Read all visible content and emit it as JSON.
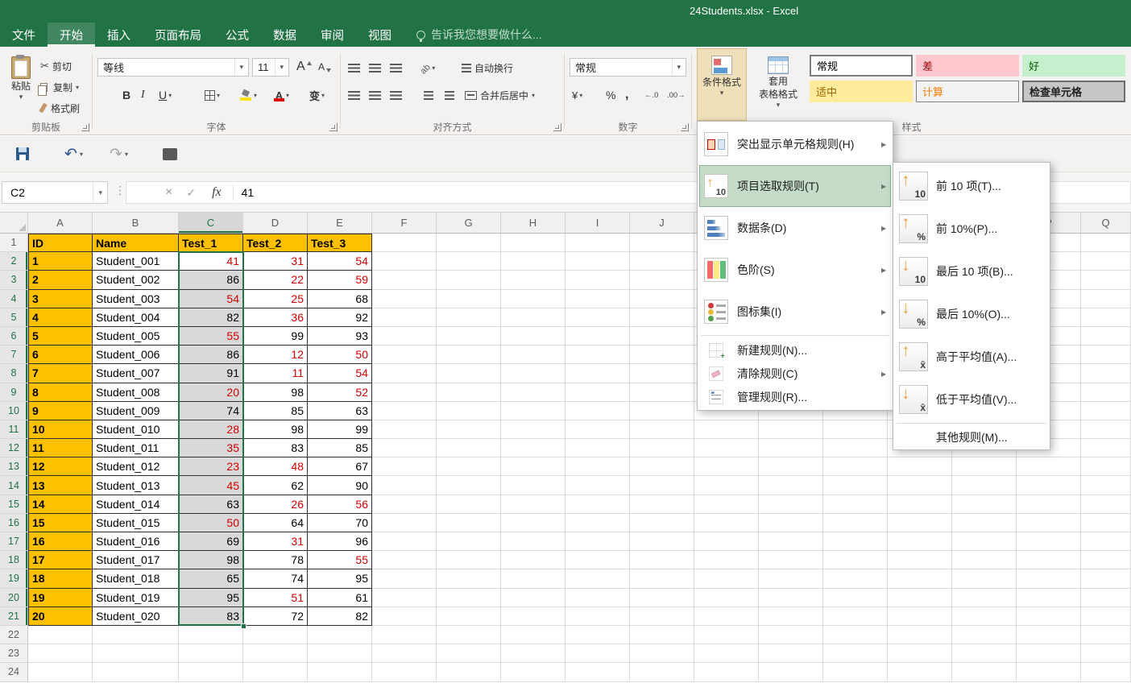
{
  "titlebar": {
    "title": "24Students.xlsx - Excel"
  },
  "tabs": {
    "file": "文件",
    "items": [
      "开始",
      "插入",
      "页面布局",
      "公式",
      "数据",
      "审阅",
      "视图"
    ],
    "active": "开始",
    "tellme": "告诉我您想要做什么..."
  },
  "ribbon": {
    "clipboard": {
      "group_label": "剪贴板",
      "paste": "粘贴",
      "cut": "剪切",
      "copy": "复制",
      "format_painter": "格式刷"
    },
    "font": {
      "group_label": "字体",
      "font_name": "等线",
      "font_size": "11",
      "bold_glyph": "B",
      "italic_glyph": "I",
      "underline_glyph": "U",
      "grow_font_glyph": "A",
      "shrink_font_glyph": "A",
      "font_color_glyph": "A",
      "phonetic_glyph": "变"
    },
    "alignment": {
      "group_label": "对齐方式",
      "wrap_text": "自动换行",
      "merge_center": "合并后居中"
    },
    "number": {
      "group_label": "数字",
      "format": "常规",
      "accounting_glyph": "¥",
      "percent_glyph": "%",
      "comma_glyph": ",",
      "increase_decimal_glyph": "←.0",
      "decrease_decimal_glyph": ".00→"
    },
    "styles": {
      "group_label": "样式",
      "conditional_formatting": "条件格式",
      "format_as_table_line1": "套用",
      "format_as_table_line2": "表格格式",
      "gallery": [
        {
          "label": "常规"
        },
        {
          "label": "差"
        },
        {
          "label": "好"
        },
        {
          "label": "适中"
        },
        {
          "label": "计算"
        },
        {
          "label": "检查单元格"
        }
      ]
    }
  },
  "quick_access": {
    "undo_glyph": "↶",
    "redo_glyph": "↷"
  },
  "formula_bar": {
    "name_box": "C2",
    "cancel_glyph": "×",
    "enter_glyph": "✓",
    "fx_glyph": "fx",
    "value": "41"
  },
  "cf_menu": {
    "items": [
      {
        "label": "突出显示单元格规则(H)",
        "icon": "highlight-cells-rules-icon",
        "has_submenu": true
      },
      {
        "label": "项目选取规则(T)",
        "icon": "top-bottom-rules-icon",
        "has_submenu": true,
        "highlighted": true,
        "icon_arrow": "↑",
        "icon_text": "10"
      },
      {
        "label": "数据条(D)",
        "icon": "data-bars-icon",
        "has_submenu": true
      },
      {
        "label": "色阶(S)",
        "icon": "color-scales-icon",
        "has_submenu": true
      },
      {
        "label": "图标集(I)",
        "icon": "icon-sets-icon",
        "has_submenu": true
      },
      {
        "label": "新建规则(N)...",
        "icon": "new-rule-icon",
        "has_submenu": false
      },
      {
        "label": "清除规则(C)",
        "icon": "clear-rules-icon",
        "has_submenu": true
      },
      {
        "label": "管理规则(R)...",
        "icon": "manage-rules-icon",
        "has_submenu": false
      }
    ]
  },
  "cf_submenu": {
    "items": [
      {
        "label": "前 10 项(T)...",
        "icon_arrow": "↑",
        "icon_text": "10"
      },
      {
        "label": "前 10%(P)...",
        "icon_arrow": "↑",
        "icon_text": "%"
      },
      {
        "label": "最后 10 项(B)...",
        "icon_arrow": "↓",
        "icon_text": "10"
      },
      {
        "label": "最后 10%(O)...",
        "icon_arrow": "↓",
        "icon_text": "%"
      },
      {
        "label": "高于平均值(A)...",
        "icon_arrow": "↑",
        "icon_text": "x̄"
      },
      {
        "label": "低于平均值(V)...",
        "icon_arrow": "↓",
        "icon_text": "x̄"
      },
      {
        "label": "其他规则(M)...",
        "icon_arrow": "",
        "icon_text": ""
      }
    ]
  },
  "grid": {
    "visible_columns": [
      "A",
      "B",
      "C",
      "D",
      "E",
      "F",
      "G",
      "H",
      "I",
      "J",
      "K",
      "L",
      "M",
      "N",
      "O",
      "P",
      "Q"
    ],
    "visible_row_count": 24,
    "header_row": [
      "ID",
      "Name",
      "Test_1",
      "Test_2",
      "Test_3"
    ],
    "students": [
      {
        "id": "1",
        "name": "Student_001",
        "scores": [
          {
            "v": 41,
            "red": true
          },
          {
            "v": 31,
            "red": true
          },
          {
            "v": 54,
            "red": true
          }
        ]
      },
      {
        "id": "2",
        "name": "Student_002",
        "scores": [
          {
            "v": 86,
            "red": false
          },
          {
            "v": 22,
            "red": true
          },
          {
            "v": 59,
            "red": true
          }
        ]
      },
      {
        "id": "3",
        "name": "Student_003",
        "scores": [
          {
            "v": 54,
            "red": true
          },
          {
            "v": 25,
            "red": true
          },
          {
            "v": 68,
            "red": false
          }
        ]
      },
      {
        "id": "4",
        "name": "Student_004",
        "scores": [
          {
            "v": 82,
            "red": false
          },
          {
            "v": 36,
            "red": true
          },
          {
            "v": 92,
            "red": false
          }
        ]
      },
      {
        "id": "5",
        "name": "Student_005",
        "scores": [
          {
            "v": 55,
            "red": true
          },
          {
            "v": 99,
            "red": false
          },
          {
            "v": 93,
            "red": false
          }
        ]
      },
      {
        "id": "6",
        "name": "Student_006",
        "scores": [
          {
            "v": 86,
            "red": false
          },
          {
            "v": 12,
            "red": true
          },
          {
            "v": 50,
            "red": true
          }
        ]
      },
      {
        "id": "7",
        "name": "Student_007",
        "scores": [
          {
            "v": 91,
            "red": false
          },
          {
            "v": 11,
            "red": true
          },
          {
            "v": 54,
            "red": true
          }
        ]
      },
      {
        "id": "8",
        "name": "Student_008",
        "scores": [
          {
            "v": 20,
            "red": true
          },
          {
            "v": 98,
            "red": false
          },
          {
            "v": 52,
            "red": true
          }
        ]
      },
      {
        "id": "9",
        "name": "Student_009",
        "scores": [
          {
            "v": 74,
            "red": false
          },
          {
            "v": 85,
            "red": false
          },
          {
            "v": 63,
            "red": false
          }
        ]
      },
      {
        "id": "10",
        "name": "Student_010",
        "scores": [
          {
            "v": 28,
            "red": true
          },
          {
            "v": 98,
            "red": false
          },
          {
            "v": 99,
            "red": false
          }
        ]
      },
      {
        "id": "11",
        "name": "Student_011",
        "scores": [
          {
            "v": 35,
            "red": true
          },
          {
            "v": 83,
            "red": false
          },
          {
            "v": 85,
            "red": false
          }
        ]
      },
      {
        "id": "12",
        "name": "Student_012",
        "scores": [
          {
            "v": 23,
            "red": true
          },
          {
            "v": 48,
            "red": true
          },
          {
            "v": 67,
            "red": false
          }
        ]
      },
      {
        "id": "13",
        "name": "Student_013",
        "scores": [
          {
            "v": 45,
            "red": true
          },
          {
            "v": 62,
            "red": false
          },
          {
            "v": 90,
            "red": false
          }
        ]
      },
      {
        "id": "14",
        "name": "Student_014",
        "scores": [
          {
            "v": 63,
            "red": false
          },
          {
            "v": 26,
            "red": true
          },
          {
            "v": 56,
            "red": true
          }
        ]
      },
      {
        "id": "15",
        "name": "Student_015",
        "scores": [
          {
            "v": 50,
            "red": true
          },
          {
            "v": 64,
            "red": false
          },
          {
            "v": 70,
            "red": false
          }
        ]
      },
      {
        "id": "16",
        "name": "Student_016",
        "scores": [
          {
            "v": 69,
            "red": false
          },
          {
            "v": 31,
            "red": true
          },
          {
            "v": 96,
            "red": false
          }
        ]
      },
      {
        "id": "17",
        "name": "Student_017",
        "scores": [
          {
            "v": 98,
            "red": false
          },
          {
            "v": 78,
            "red": false
          },
          {
            "v": 55,
            "red": true
          }
        ]
      },
      {
        "id": "18",
        "name": "Student_018",
        "scores": [
          {
            "v": 65,
            "red": false
          },
          {
            "v": 74,
            "red": false
          },
          {
            "v": 95,
            "red": false
          }
        ]
      },
      {
        "id": "19",
        "name": "Student_019",
        "scores": [
          {
            "v": 95,
            "red": false
          },
          {
            "v": 51,
            "red": true
          },
          {
            "v": 61,
            "red": false
          }
        ]
      },
      {
        "id": "20",
        "name": "Student_020",
        "scores": [
          {
            "v": 83,
            "red": false
          },
          {
            "v": 72,
            "red": false
          },
          {
            "v": 82,
            "red": false
          }
        ]
      }
    ],
    "selection": {
      "range": "C2:C21",
      "active_cell": "C2"
    }
  },
  "colors": {
    "accent_green": "#217346",
    "header_fill": "#FFC000",
    "red_text": "#D00000",
    "selection_fill": "#D9D9D9"
  }
}
